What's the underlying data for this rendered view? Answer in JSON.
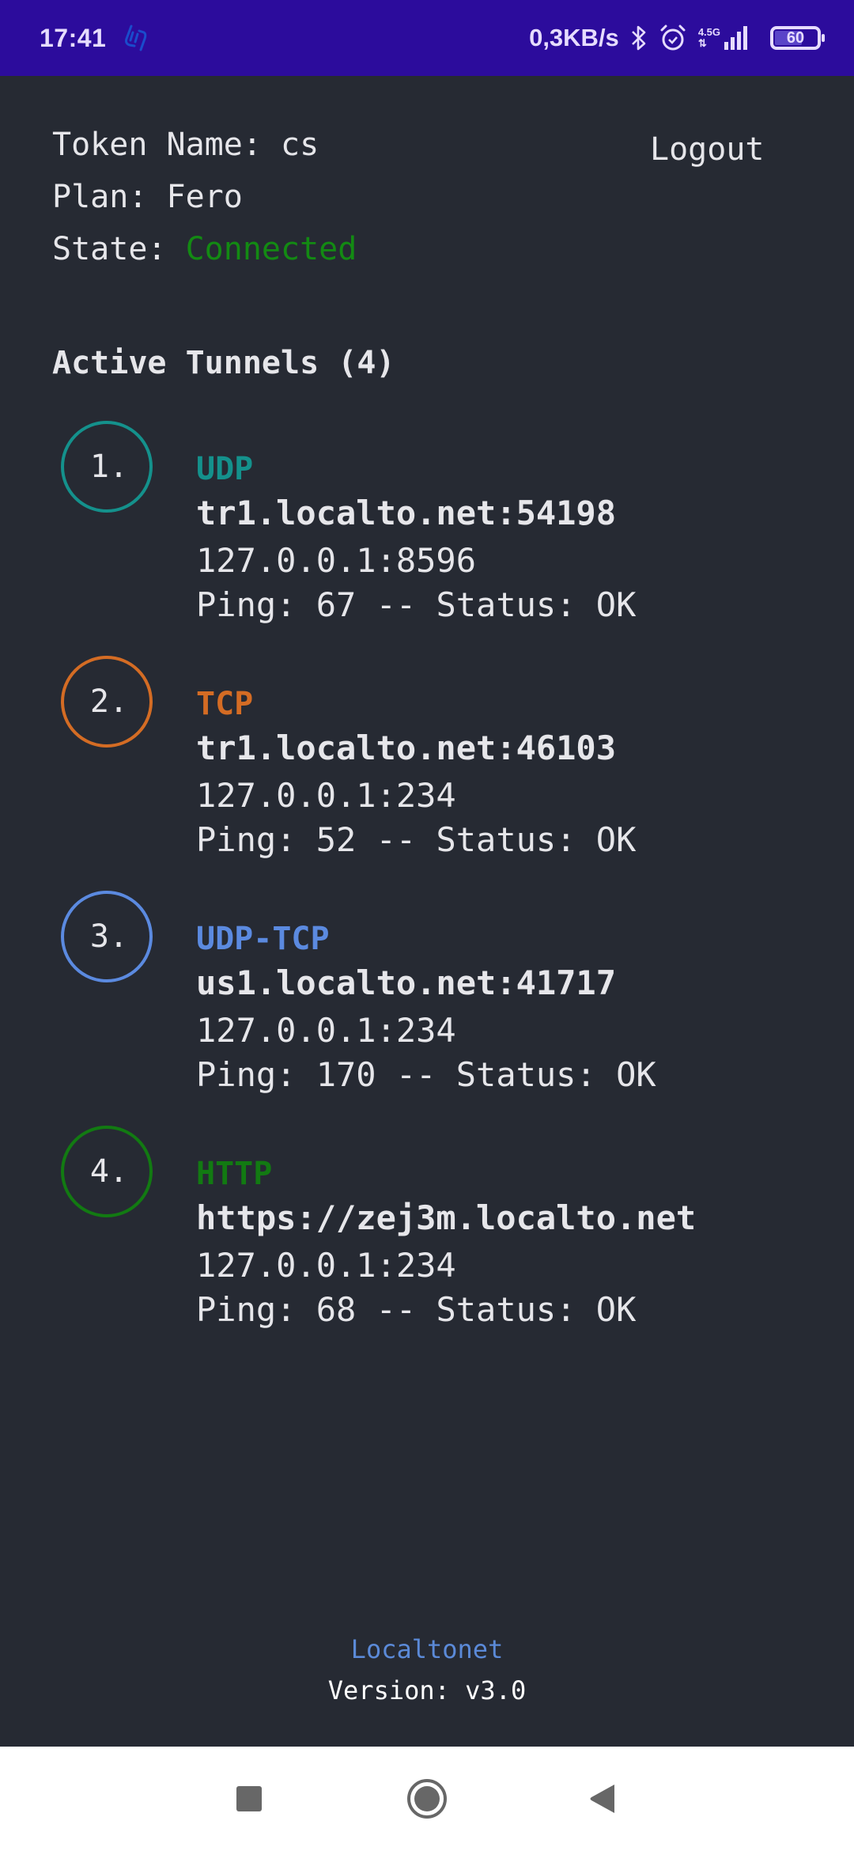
{
  "status_bar": {
    "time": "17:41",
    "notification_icon": "localtonet-app-icon",
    "net_speed": "0,3KB/s",
    "bluetooth_icon": "bluetooth-icon",
    "alarm_icon": "alarm-icon",
    "network_type": "4.5G",
    "signal_icon": "signal-bars-icon",
    "battery_level": "60",
    "battery_fraction": 0.6,
    "background": "#2c0c9c"
  },
  "account": {
    "token_label": "Token Name:",
    "token_value": "cs",
    "plan_label": "Plan:",
    "plan_value": "Fero",
    "state_label": "State:",
    "state_value": "Connected",
    "state_color": "#138a13"
  },
  "logout_label": "Logout",
  "tunnels_title": "Active Tunnels (4)",
  "tunnels": [
    {
      "index": "1.",
      "type": "UDP",
      "color": "#14918c",
      "host": "tr1.localto.net:54198",
      "local": "127.0.0.1:8596",
      "ping_label": "Ping:",
      "ping": "67",
      "status_label": "Status:",
      "status": "OK"
    },
    {
      "index": "2.",
      "type": "TCP",
      "color": "#d46c24",
      "host": "tr1.localto.net:46103",
      "local": "127.0.0.1:234",
      "ping_label": "Ping:",
      "ping": "52",
      "status_label": "Status:",
      "status": "OK"
    },
    {
      "index": "3.",
      "type": "UDP-TCP",
      "color": "#5b8ae0",
      "host": "us1.localto.net:41717",
      "local": "127.0.0.1:234",
      "ping_label": "Ping:",
      "ping": "170",
      "status_label": "Status:",
      "status": "OK"
    },
    {
      "index": "4.",
      "type": "HTTP",
      "color": "#127a12",
      "host": "https://zej3m.localto.net",
      "local": "127.0.0.1:234",
      "ping_label": "Ping:",
      "ping": "68",
      "status_label": "Status:",
      "status": "OK"
    }
  ],
  "footer": {
    "brand": "Localtonet",
    "version": "Version: v3.0"
  },
  "nav_bar": {
    "recents": "recents-square-icon",
    "home": "home-circle-icon",
    "back": "back-triangle-icon"
  }
}
